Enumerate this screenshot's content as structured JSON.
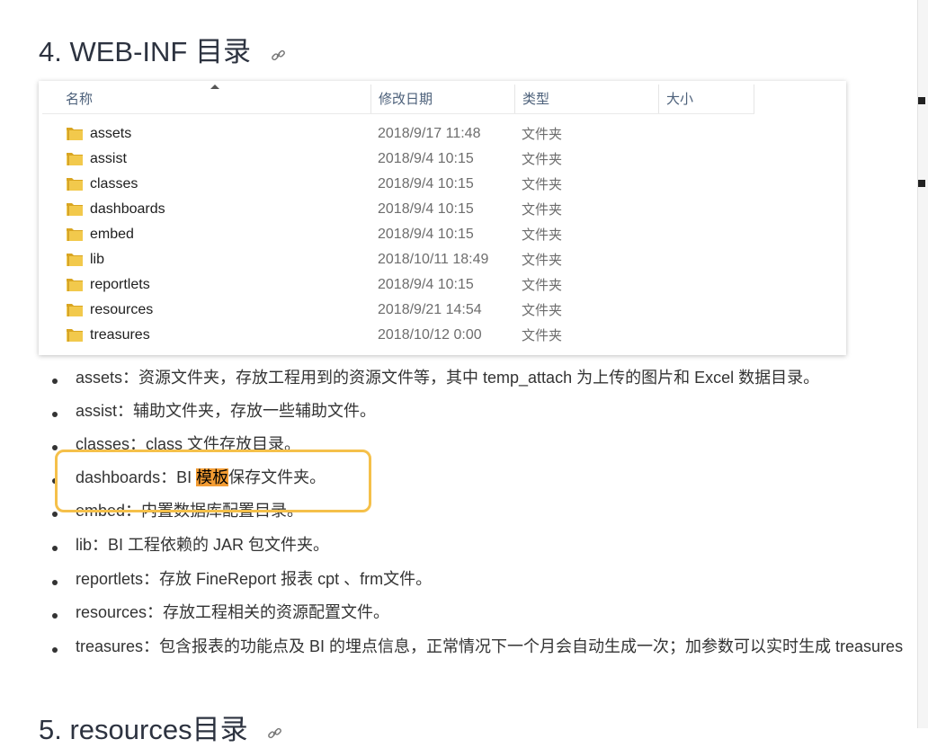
{
  "heading4": {
    "text": "4. WEB-INF 目录"
  },
  "heading5": {
    "text": "5. resources目录"
  },
  "explorer": {
    "columns": {
      "name": "名称",
      "modified": "修改日期",
      "type": "类型",
      "size": "大小"
    },
    "rows": [
      {
        "name": "assets",
        "date": "2018/9/17 11:48",
        "type": "文件夹"
      },
      {
        "name": "assist",
        "date": "2018/9/4 10:15",
        "type": "文件夹"
      },
      {
        "name": "classes",
        "date": "2018/9/4 10:15",
        "type": "文件夹"
      },
      {
        "name": "dashboards",
        "date": "2018/9/4 10:15",
        "type": "文件夹"
      },
      {
        "name": "embed",
        "date": "2018/9/4 10:15",
        "type": "文件夹"
      },
      {
        "name": "lib",
        "date": "2018/10/11 18:49",
        "type": "文件夹"
      },
      {
        "name": "reportlets",
        "date": "2018/9/4 10:15",
        "type": "文件夹"
      },
      {
        "name": "resources",
        "date": "2018/9/21 14:54",
        "type": "文件夹"
      },
      {
        "name": "treasures",
        "date": "2018/10/12 0:00",
        "type": "文件夹"
      }
    ]
  },
  "bullets": [
    {
      "text": "assets：资源文件夹，存放工程用到的资源文件等，其中 temp_attach 为上传的图片和 Excel 数据目录。"
    },
    {
      "text": "assist：辅助文件夹，存放一些辅助文件。"
    },
    {
      "text": "classes：class 文件存放目录。"
    },
    {
      "pre": "dashboards：BI ",
      "highlight": "模板",
      "post": "保存文件夹。"
    },
    {
      "text": "embed：内置数据库配置目录。"
    },
    {
      "text": "lib：BI 工程依赖的 JAR 包文件夹。"
    },
    {
      "text": "reportlets：存放 FineReport 报表 cpt 、frm文件。"
    },
    {
      "text": "resources：存放工程相关的资源配置文件。"
    },
    {
      "text": "treasures：包含报表的功能点及 BI 的埋点信息，正常情况下一个月会自动生成一次；加参数可以实时生成 treasures"
    }
  ],
  "colors": {
    "highlight": "#f39c33",
    "callout_border": "#f5c04a",
    "folder": "#e8b93a"
  },
  "icons": {
    "anchor": "link-icon",
    "folder": "folder-icon"
  }
}
